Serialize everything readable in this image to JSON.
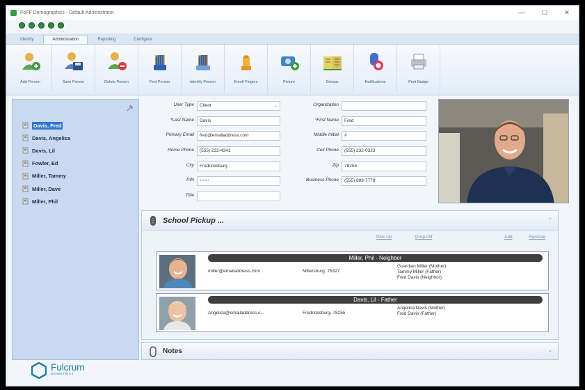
{
  "window": {
    "title": "FoFF Demographics - Default Administrator",
    "controls": [
      "—",
      "☐",
      "✕"
    ]
  },
  "quick_access": [
    "undo",
    "redo",
    "refresh",
    "back",
    "forward"
  ],
  "tabs": [
    {
      "label": "Identity",
      "active": false
    },
    {
      "label": "Administration",
      "active": true
    },
    {
      "label": "Reporting",
      "active": false
    },
    {
      "label": "Configure",
      "active": false
    }
  ],
  "ribbon": [
    {
      "label": "Add Person",
      "icon": "add-person-icon"
    },
    {
      "label": "Save Person",
      "icon": "save-person-icon"
    },
    {
      "label": "Delete Person",
      "icon": "delete-person-icon"
    },
    {
      "label": "Find Person",
      "icon": "find-person-icon"
    },
    {
      "label": "Identify Person",
      "icon": "identify-person-icon"
    },
    {
      "label": "Enroll Fingers",
      "icon": "enroll-fingers-icon"
    },
    {
      "label": "Picture",
      "icon": "picture-icon"
    },
    {
      "label": "Groups",
      "icon": "groups-icon"
    },
    {
      "label": "Notifications",
      "icon": "notifications-icon"
    },
    {
      "label": "Print Badge",
      "icon": "print-badge-icon"
    }
  ],
  "people": [
    {
      "name": "Davis, Fred",
      "selected": true
    },
    {
      "name": "Davis, Angelica",
      "selected": false
    },
    {
      "name": "Davis, Lil",
      "selected": false
    },
    {
      "name": "Fowler, Ed",
      "selected": false
    },
    {
      "name": "Miller, Tammy",
      "selected": false
    },
    {
      "name": "Miller, Dave",
      "selected": false
    },
    {
      "name": "Miller, Phil",
      "selected": false
    }
  ],
  "form": {
    "user_type": {
      "label": "User Type",
      "value": "Client"
    },
    "last_name": {
      "label": "*Last Name",
      "value": "Davis"
    },
    "primary_email": {
      "label": "Primary Email",
      "value": "fred@emailaddress.com"
    },
    "home_phone": {
      "label": "Home Phone",
      "value": "(555) 232-4341"
    },
    "city": {
      "label": "City",
      "value": "Fredricksburg"
    },
    "pin": {
      "label": "PIN",
      "value": "••••••"
    },
    "title": {
      "label": "Title",
      "value": ""
    },
    "organization": {
      "label": "Organization",
      "value": ""
    },
    "first_name": {
      "label": "*First Name",
      "value": "Fred"
    },
    "middle_initial": {
      "label": "Middle Initial",
      "value": "#"
    },
    "cell_phone": {
      "label": "Cell Phone",
      "value": "(555) 232-0323"
    },
    "zip": {
      "label": "Zip",
      "value": "78255"
    },
    "business_phone": {
      "label": "Business Phone",
      "value": "(555) 888-7778"
    }
  },
  "school_pickup": {
    "title": "School Pickup ...",
    "columns": [
      "Pick Up",
      "Drop Off",
      "Add",
      "Remove"
    ],
    "children": [
      {
        "name": "Miller, Phil - Neighbor",
        "email": "miller@emailaddress.com",
        "city_zip": "Millersburg, 75327",
        "guardians": [
          "Guardian Miller (Mother)",
          "Tammy Miller (Father)",
          "Fred Davis (Neighbor)"
        ]
      },
      {
        "name": "Davis, Lil - Father",
        "email": "Angelica@emailaddress.c...",
        "city_zip": "Fredricksburg, 78255",
        "guardians": [
          "Angelica Davis (Mother)",
          "Fred Davis (Father)"
        ]
      }
    ]
  },
  "notes": {
    "title": "Notes"
  },
  "logo": {
    "name": "Fulcrum",
    "tagline": "BIOMETRICS"
  },
  "colors": {
    "selection": "#3373d1",
    "panel": "#c9daf0",
    "accent": "#1c7ea6"
  }
}
